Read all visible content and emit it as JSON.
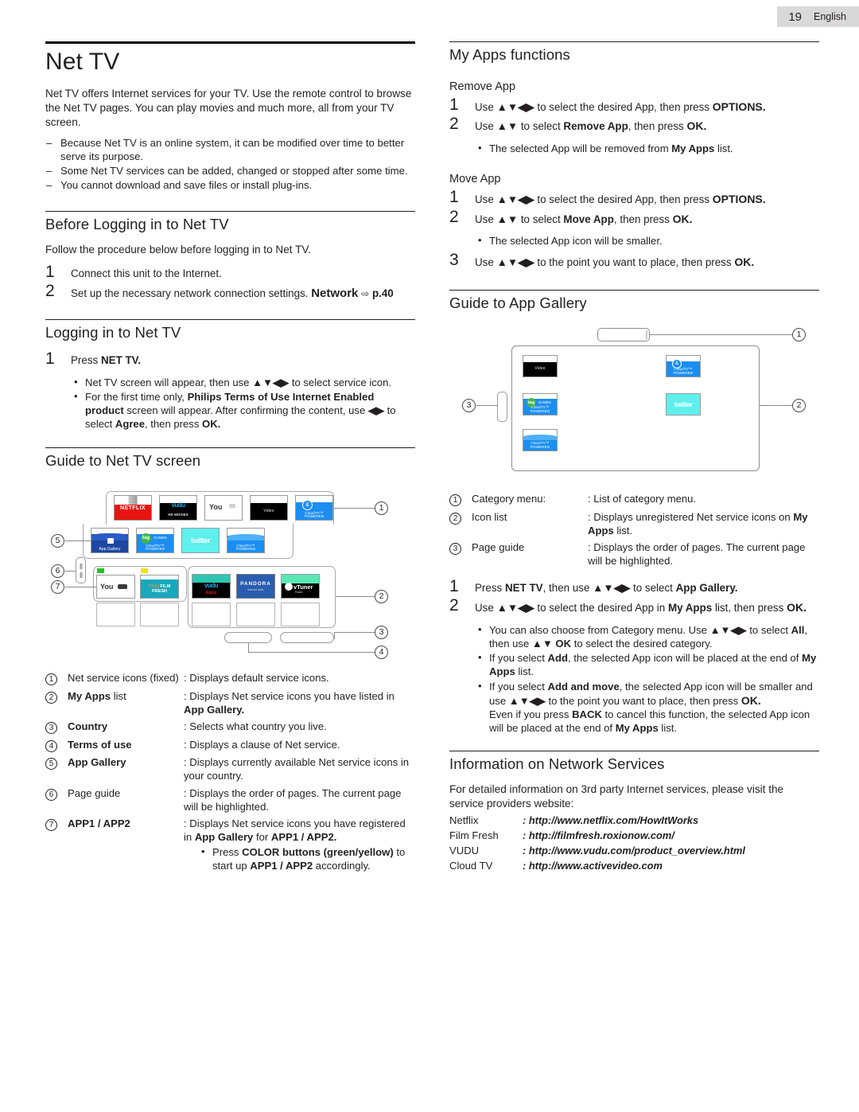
{
  "page_header": {
    "number": "19",
    "language": "English"
  },
  "doc": {
    "title": "Net TV",
    "intro": "Net TV offers Internet services for your TV. Use the remote control to browse the Net TV pages. You can play movies and much more, all from your TV screen.",
    "notes": [
      "Because Net TV is an online system, it can be modified over time to better serve its purpose.",
      "Some Net TV services can be added, changed or stopped after some time.",
      "You cannot download and save files or install plug-ins."
    ]
  },
  "before_logging": {
    "heading": "Before Logging in to Net TV",
    "lead": "Follow the procedure below before logging in to Net TV.",
    "steps": [
      {
        "num": "1",
        "text": "Connect this unit to the Internet."
      },
      {
        "num": "2",
        "text_pre": "Set up the necessary network connection settings.",
        "bold": "Network",
        "arrow": "⇨",
        "page_ref": "p.40"
      }
    ]
  },
  "logging_in": {
    "heading": "Logging in to Net TV",
    "step1_num": "1",
    "step1_pre": "Press",
    "step1_bold": "NET TV.",
    "bullets": [
      {
        "pre": "Net TV screen will appear, then use",
        "keys": "▲▼◀▶",
        "post": "to select service icon."
      },
      {
        "pre": "For the first time only,",
        "bold1": "Philips Terms of Use Internet Enabled product",
        "mid": "screen will appear. After confirming the content, use",
        "keys": "◀▶",
        "mid2": "to select",
        "bold2": "Agree",
        "post": ", then press",
        "bold3": "OK."
      }
    ]
  },
  "guide_nettv": {
    "heading": "Guide to Net TV screen",
    "diagram": {
      "fixed_icons": [
        {
          "name": "netflix-tile",
          "label": "NETFLIX"
        },
        {
          "name": "vudu-tile",
          "label": "HD MOVIES"
        },
        {
          "name": "youtube-tile",
          "label": "You"
        },
        {
          "name": "video-tile",
          "label": "Video"
        },
        {
          "name": "cloudtv-accuweather-tile",
          "label": "CloudTV™ POWERED"
        },
        {
          "name": "app-gallery-tile",
          "label": "App Gallery"
        },
        {
          "name": "tag-games-tile",
          "label": "CloudTV™ POWERED"
        },
        {
          "name": "twitter-tile",
          "label": "twitter"
        },
        {
          "name": "cloudtv-blue-tile",
          "label": "CloudTV™ POWERED"
        }
      ],
      "app_icons": [
        {
          "name": "youtube-app1-tile",
          "label": "You"
        },
        {
          "name": "filmfresh-app2-tile",
          "label": "FILM FRESH"
        },
        {
          "name": "vudu-apps-tile",
          "label": "Apps"
        },
        {
          "name": "pandora-tile",
          "label": "PANDORA"
        },
        {
          "name": "vtuner-tile",
          "label": "vTuner"
        }
      ],
      "callouts": [
        "1",
        "2",
        "3",
        "4",
        "5",
        "6",
        "7"
      ]
    },
    "legend": [
      {
        "num": "1",
        "term": "Net service icons (fixed)",
        "term_bold": false,
        "desc": ": Displays default service icons."
      },
      {
        "num": "2",
        "term": "My Apps",
        "term_tail": " list",
        "term_bold": true,
        "desc": ": Displays Net service icons you have listed in ",
        "desc_bold": "App Gallery."
      },
      {
        "num": "3",
        "term": "Country",
        "term_bold": true,
        "desc": ": Selects what country you live."
      },
      {
        "num": "4",
        "term": "Terms of use",
        "term_bold": true,
        "desc": ": Displays a clause of Net service."
      },
      {
        "num": "5",
        "term": "App Gallery",
        "term_bold": true,
        "desc": ": Displays currently available Net service icons in your country."
      },
      {
        "num": "6",
        "term": "Page guide",
        "term_bold": false,
        "desc": ": Displays the order of pages. The current page will be highlighted."
      },
      {
        "num": "7",
        "term": "APP1 / APP2",
        "term_bold": true,
        "desc": ": Displays Net service icons you have registered in ",
        "desc_bold": "App Gallery",
        "desc_tail": " for ",
        "desc_bold2": "APP1 / APP2.",
        "bullet_pre": "Press ",
        "bullet_bold": "COLOR buttons (green/yellow)",
        "bullet_post": " to start up ",
        "bullet_bold2": "APP1 / APP2",
        "bullet_tail": " accordingly."
      }
    ]
  },
  "myapps_functions": {
    "heading": "My Apps functions",
    "remove_app": {
      "title": "Remove App",
      "steps": [
        {
          "num": "1",
          "pre": "Use",
          "keys": "▲▼◀▶",
          "mid": "to select the desired App, then press",
          "bold": "OPTIONS."
        },
        {
          "num": "2",
          "pre": "Use",
          "keys": "▲▼",
          "mid": "to select",
          "bold1": "Remove App",
          "post": ", then press",
          "bold2": "OK."
        }
      ],
      "bullet_pre": "The selected App will be removed from ",
      "bullet_bold": "My Apps",
      "bullet_post": " list."
    },
    "move_app": {
      "title": "Move App",
      "steps": [
        {
          "num": "1",
          "pre": "Use",
          "keys": "▲▼◀▶",
          "mid": "to select the desired App, then press",
          "bold": "OPTIONS."
        },
        {
          "num": "2",
          "pre": "Use",
          "keys": "▲▼",
          "mid": "to select",
          "bold1": "Move App",
          "post": ", then press",
          "bold2": "OK."
        },
        {
          "num": "3",
          "pre": "Use",
          "keys": "▲▼◀▶",
          "mid": "to the point you want to place, then press",
          "bold": "OK."
        }
      ],
      "bullet": "The selected App icon will be smaller."
    }
  },
  "guide_gallery": {
    "heading": "Guide to App Gallery",
    "diagram": {
      "icons": [
        {
          "name": "video-tile",
          "label": "Video"
        },
        {
          "name": "cloudtv-accuweather-tile",
          "label": "CloudTV™ POWERED"
        },
        {
          "name": "tag-games-tile",
          "label": "CloudTV™ POWERED"
        },
        {
          "name": "twitter-tile",
          "label": "twitter"
        },
        {
          "name": "cloudtv-blue-tile",
          "label": "CloudTV™ POWERED"
        }
      ],
      "callouts": [
        "1",
        "2",
        "3"
      ]
    },
    "legend": [
      {
        "num": "1",
        "term": "Category menu:",
        "desc": ": List of category menu."
      },
      {
        "num": "2",
        "term": "Icon list",
        "desc": ": Displays unregistered Net service icons on ",
        "desc_bold": "My Apps",
        "desc_tail": " list."
      },
      {
        "num": "3",
        "term": "Page guide",
        "desc": ": Displays the order of pages. The current page will be highlighted."
      }
    ],
    "steps": [
      {
        "num": "1",
        "pre": "Press",
        "bold1": "NET TV",
        "mid": ", then use",
        "keys": "▲▼◀▶",
        "post": "to select",
        "bold2": "App Gallery."
      },
      {
        "num": "2",
        "pre": "Use",
        "keys": "▲▼◀▶",
        "mid": "to select the desired App in",
        "bold1": "My Apps",
        "post": "list, then press",
        "bold2": "OK."
      }
    ],
    "bullets": [
      {
        "pre": "You can also choose from Category menu. Use",
        "keys": "▲▼◀▶",
        "mid": "to select",
        "bold1": "All",
        "post": ", then use",
        "keys2": "▲▼ OK",
        "tail": "to select the desired category."
      },
      {
        "pre": "If you select ",
        "bold1": "Add",
        "mid": ", the selected App icon will be placed at the end of ",
        "bold2": "My Apps",
        "tail": " list."
      },
      {
        "pre": "If you select ",
        "bold1": "Add and move",
        "mid": ", the selected App icon will be smaller and use",
        "keys": "▲▼◀▶",
        "mid2": "to the point you want to place, then press",
        "bold2": "OK.",
        "extra_pre": "Even if you press ",
        "extra_bold": "BACK",
        "extra_mid": " to cancel this function, the selected App icon will be placed at the end of ",
        "extra_bold2": "My Apps",
        "extra_tail": " list."
      }
    ]
  },
  "network_services": {
    "heading": "Information on Network Services",
    "lead": "For detailed information on 3rd party Internet services, please visit the service providers website:",
    "rows": [
      {
        "name": "Netflix",
        "url": ": http://www.netflix.com/HowItWorks"
      },
      {
        "name": "Film Fresh",
        "url": ": http://filmfresh.roxionow.com/"
      },
      {
        "name": "VUDU",
        "url": ": http://www.vudu.com/product_overview.html"
      },
      {
        "name": "Cloud TV",
        "url": ": http://www.activevideo.com"
      }
    ]
  },
  "colors": {
    "netflix_red": "#e8140f",
    "vudu_black": "#000000",
    "cloudtv_blue": "#1b8ef0",
    "twitter_cyan": "#5ef0ed",
    "tag_green": "#3fb54a",
    "filmfresh_teal": "#17a8bd",
    "pandora_blue": "#2a5cb0",
    "vtuner_green": "#59e8b4",
    "appgallery_navy": "#1d47a0",
    "flag_green": "#22c522",
    "flag_yellow": "#f2e315"
  }
}
